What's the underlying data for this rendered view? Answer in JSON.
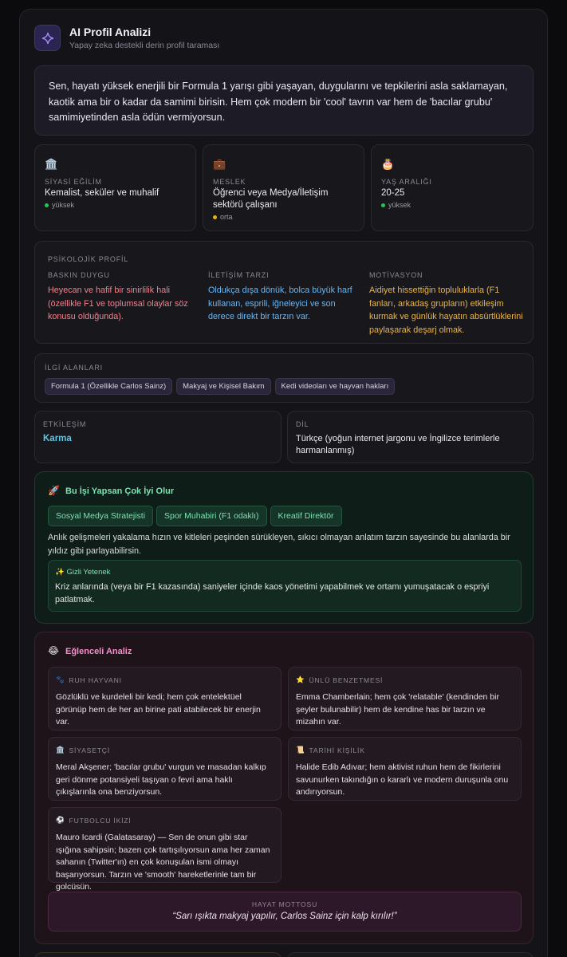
{
  "header": {
    "title": "AI Profil Analizi",
    "subtitle": "Yapay zeka destekli derin profil taraması",
    "icon": "sparkle-icon"
  },
  "summary": "Sen, hayatı yüksek enerjili bir Formula 1 yarışı gibi yaşayan, duygularını ve tepkilerini asla saklamayan, kaotik ama bir o kadar da samimi birisin. Hem çok modern bir 'cool' tavrın var hem de 'bacılar grubu' samimiyetinden asla ödün vermiyorsun.",
  "stats": [
    {
      "icon": "🏛️",
      "label": "SİYASİ EĞİLİM",
      "value": "Kemalist, seküler ve muhalif",
      "confidence": "yüksek",
      "dot_color": "#22c55e"
    },
    {
      "icon": "💼",
      "label": "MESLEK",
      "value": "Öğrenci veya Medya/İletişim sektörü çalışanı",
      "confidence": "orta",
      "dot_color": "#eab308"
    },
    {
      "icon": "🎂",
      "label": "YAŞ ARALIĞI",
      "value": "20-25",
      "confidence": "yüksek",
      "dot_color": "#22c55e"
    }
  ],
  "psychology": {
    "label": "PSİKOLOJİK PROFİL",
    "columns": [
      {
        "label": "BASKIN DUYGU",
        "text": "Heyecan ve hafif bir sinirlilik hali (özellikle F1 ve toplumsal olaylar söz konusu olduğunda).",
        "color": "#f0828c"
      },
      {
        "label": "İLETİŞİM TARZI",
        "text": "Oldukça dışa dönük, bolca büyük harf kullanan, esprili, iğneleyici ve son derece direkt bir tarzın var.",
        "color": "#6ab7f2"
      },
      {
        "label": "MOTİVASYON",
        "text": "Aidiyet hissettiğin topluluklarla (F1 fanları, arkadaş grupların) etkileşim kurmak ve günlük hayatın absürtlüklerini paylaşarak deşarj olmak.",
        "color": "#eab54a"
      }
    ]
  },
  "interests": {
    "label": "İLGİ ALANLARI",
    "items": [
      "Formula 1 (Özellikle Carlos Sainz)",
      "Makyaj ve Kişisel Bakım",
      "Kedi videoları ve hayvan hakları"
    ]
  },
  "engagement": {
    "label": "ETKİLEŞİM",
    "value": "Karma",
    "color": "#5ec8e6"
  },
  "language": {
    "label": "DİL",
    "value": "Türkçe (yoğun internet jargonu ve İngilizce terimlerle harmanlanmış)"
  },
  "career": {
    "title": "Bu İşi Yapsan Çok İyi Olur",
    "icon": "🚀",
    "jobs": [
      "Sosyal Medya Stratejisti",
      "Spor Muhabiri (F1 odaklı)",
      "Kreatif Direktör"
    ],
    "description": "Anlık gelişmeleri yakalama hızın ve kitleleri peşinden sürükleyen, sıkıcı olmayan anlatım tarzın sayesinde bu alanlarda bir yıldız gibi parlayabilirsin.",
    "hidden_talent_label": "✨ Gizli Yetenek",
    "hidden_talent": "Kriz anlarında (veya bir F1 kazasında) saniyeler içinde kaos yönetimi yapabilmek ve ortamı yumuşatacak o espriyi patlatmak."
  },
  "fun": {
    "title": "Eğlenceli Analiz",
    "icon": "😂",
    "cards": [
      {
        "icon": "🐾",
        "label": "RUH HAYVANI",
        "text": "Gözlüklü ve kurdeleli bir kedi; hem çok entelektüel görünüp hem de her an birine pati atabilecek bir enerjin var."
      },
      {
        "icon": "⭐",
        "label": "ÜNLÜ BENZETMESİ",
        "text": "Emma Chamberlain; hem çok 'relatable' (kendinden bir şeyler bulunabilir) hem de kendine has bir tarzın ve mizahın var."
      },
      {
        "icon": "🏛️",
        "label": "SİYASETÇİ",
        "text": "Meral Akşener; 'bacılar grubu' vurgun ve masadan kalkıp geri dönme potansiyeli taşıyan o fevri ama haklı çıkışlarınla ona benziyorsun."
      },
      {
        "icon": "📜",
        "label": "TARİHİ KİŞİLİK",
        "text": "Halide Edib Adıvar; hem aktivist ruhun hem de fikirlerini savunurken takındığın o kararlı ve modern duruşunla onu andırıyorsun."
      },
      {
        "icon": "⚽",
        "label": "FUTBOLCU İKİZİ",
        "text": "Mauro Icardi (Galatasaray) — Sen de onun gibi star ışığına sahipsin; bazen çok tartışılıyorsun ama her zaman sahanın (Twitter'ın) en çok konuşulan ismi olmayı başarıyorsun. Tarzın ve 'smooth' hareketlerinle tam bir golcüsün."
      }
    ],
    "motto_label": "HAYAT MOTTOSU",
    "motto": "“Sarı ışıkta makyaj yapılır, Carlos Sainz için kalp kırılır!”"
  }
}
